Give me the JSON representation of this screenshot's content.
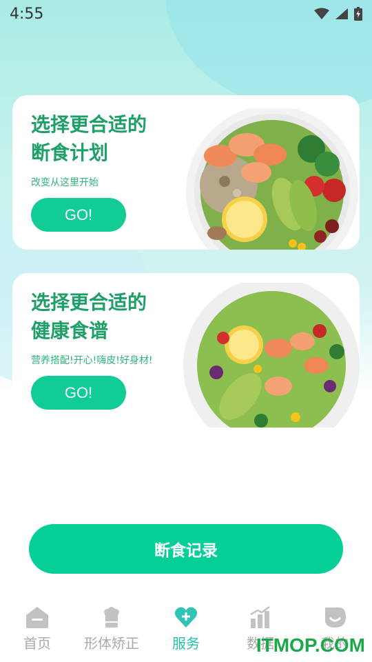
{
  "status_bar": {
    "time": "4:55"
  },
  "cards": [
    {
      "title_line1": "选择更合适的",
      "title_line2": "断食计划",
      "subtitle": "改变从这里开始",
      "button_label": "GO!"
    },
    {
      "title_line1": "选择更合适的",
      "title_line2": "健康食谱",
      "subtitle": "营养搭配!开心!嗨皮!好身材!",
      "button_label": "GO!"
    }
  ],
  "record_button": {
    "label": "断食记录"
  },
  "tabs": [
    {
      "label": "首页",
      "icon": "home-icon",
      "active": false
    },
    {
      "label": "形体矫正",
      "icon": "chef-hat-icon",
      "active": false
    },
    {
      "label": "服务",
      "icon": "heart-plus-icon",
      "active": true
    },
    {
      "label": "数据",
      "icon": "bar-chart-icon",
      "active": false
    },
    {
      "label": "我的",
      "icon": "profile-icon",
      "active": false
    }
  ],
  "colors": {
    "accent": "#05cf96",
    "title_green": "#1e9f68",
    "tab_active": "#22c2a9",
    "tab_inactive": "#a9a9a9"
  },
  "watermark": "ITMOP.COM"
}
